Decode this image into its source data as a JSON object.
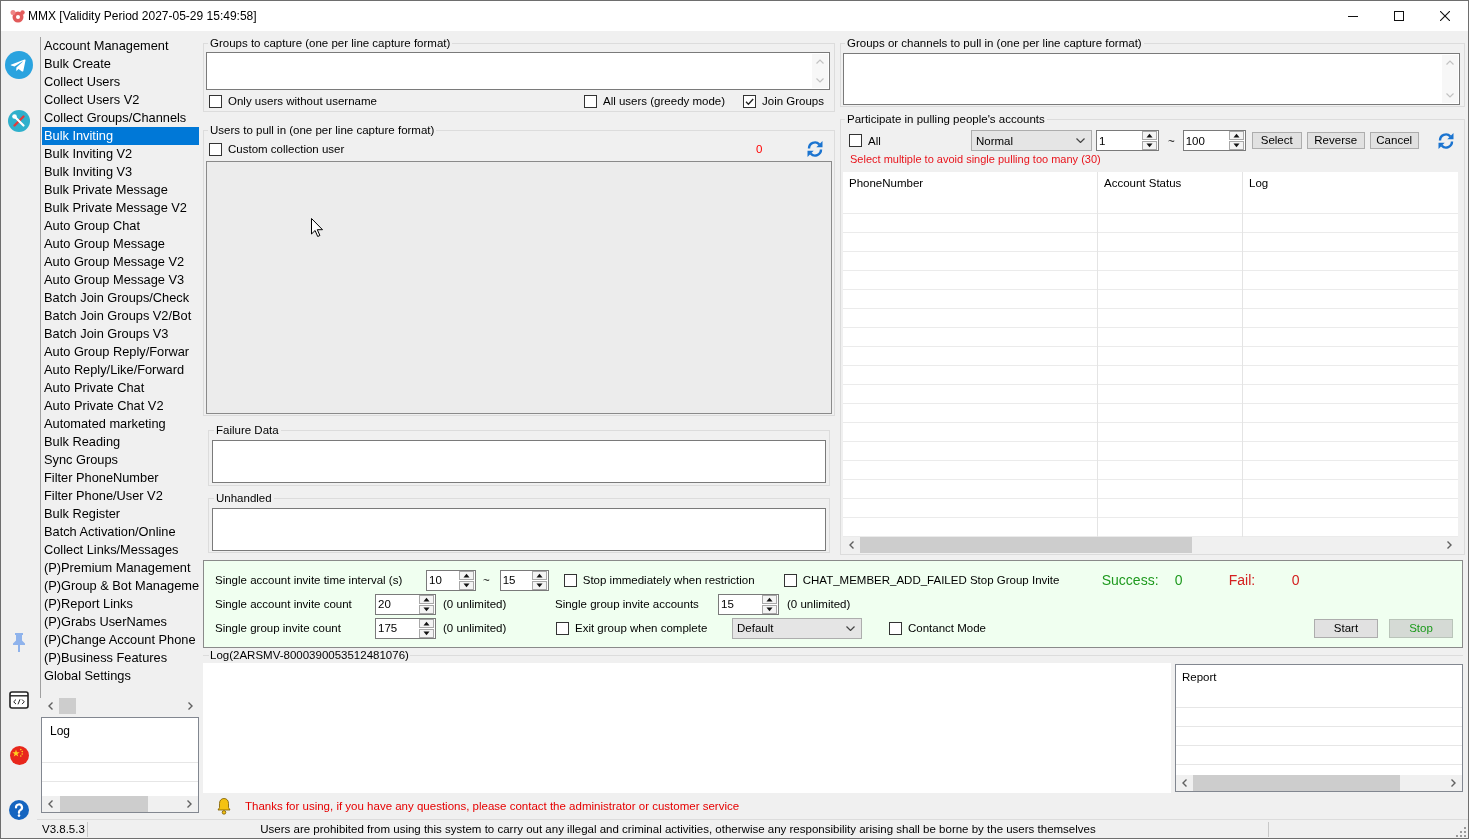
{
  "window": {
    "title": "MMX [Validity Period 2027-05-29 15:49:58]"
  },
  "sidebar": {
    "items": [
      {
        "label": "Account Management",
        "selected": false
      },
      {
        "label": "Bulk Create",
        "selected": false
      },
      {
        "label": "Collect Users",
        "selected": false
      },
      {
        "label": "Collect Users V2",
        "selected": false
      },
      {
        "label": "Collect Groups/Channels",
        "selected": false
      },
      {
        "label": "Bulk Inviting",
        "selected": true
      },
      {
        "label": "Bulk Inviting V2",
        "selected": false
      },
      {
        "label": "Bulk Inviting V3",
        "selected": false
      },
      {
        "label": "Bulk Private Message",
        "selected": false
      },
      {
        "label": "Bulk Private Message V2",
        "selected": false
      },
      {
        "label": "Auto Group Chat",
        "selected": false
      },
      {
        "label": "Auto Group Message",
        "selected": false
      },
      {
        "label": "Auto Group Message V2",
        "selected": false
      },
      {
        "label": "Auto Group Message V3",
        "selected": false
      },
      {
        "label": "Batch Join Groups/Check",
        "selected": false
      },
      {
        "label": "Batch Join Groups V2/Bot",
        "selected": false
      },
      {
        "label": "Batch Join Groups V3",
        "selected": false
      },
      {
        "label": "Auto Group Reply/Forwar",
        "selected": false
      },
      {
        "label": "Auto Reply/Like/Forward",
        "selected": false
      },
      {
        "label": "Auto Private Chat",
        "selected": false
      },
      {
        "label": "Auto Private Chat V2",
        "selected": false
      },
      {
        "label": "Automated marketing",
        "selected": false
      },
      {
        "label": "Bulk Reading",
        "selected": false
      },
      {
        "label": "Sync Groups",
        "selected": false
      },
      {
        "label": "Filter PhoneNumber",
        "selected": false
      },
      {
        "label": "Filter Phone/User V2",
        "selected": false
      },
      {
        "label": "Bulk Register",
        "selected": false
      },
      {
        "label": "Batch Activation/Online",
        "selected": false
      },
      {
        "label": "Collect Links/Messages",
        "selected": false
      },
      {
        "label": "(P)Premium Management",
        "selected": false
      },
      {
        "label": "(P)Group & Bot Manageme",
        "selected": false
      },
      {
        "label": "(P)Report Links",
        "selected": false
      },
      {
        "label": "(P)Grabs UserNames",
        "selected": false
      },
      {
        "label": "(P)Change Account Phone",
        "selected": false
      },
      {
        "label": "(P)Business Features",
        "selected": false
      },
      {
        "label": "Global Settings",
        "selected": false
      }
    ],
    "log_list": {
      "columns": [
        "Log"
      ]
    }
  },
  "capture": {
    "title": "Groups to capture (one per line capture format)",
    "options": [
      {
        "label": "Only users without username",
        "checked": false
      },
      {
        "label": "All users (greedy mode)",
        "checked": false
      },
      {
        "label": "Join Groups",
        "checked": true
      }
    ]
  },
  "pull_users": {
    "title": "Users to pull in (one per line capture format)",
    "custom": {
      "label": "Custom collection user",
      "checked": false
    },
    "count": "0"
  },
  "failure_data": {
    "title": "Failure Data"
  },
  "unhandled": {
    "title": "Unhandled"
  },
  "targets": {
    "title": "Groups or channels to pull in (one per line capture format)"
  },
  "accounts": {
    "title": "Participate in pulling people's accounts",
    "all": {
      "label": "All",
      "checked": false
    },
    "mode": "Normal",
    "range": {
      "from": "1",
      "separator": "~",
      "to": "100"
    },
    "buttons": [
      "Select",
      "Reverse",
      "Cancel"
    ],
    "hint": "Select multiple to avoid single pulling too many (30)",
    "table": {
      "columns": [
        "PhoneNumber",
        "Account Status",
        "Log"
      ]
    }
  },
  "settings": {
    "interval": {
      "label": "Single account invite time interval (s)",
      "from": "10",
      "separator": "~",
      "to": "15"
    },
    "stop_on_restriction": {
      "label": "Stop immediately when restriction",
      "checked": false
    },
    "stop_on_add_failed": {
      "label": "CHAT_MEMBER_ADD_FAILED Stop Group Invite",
      "checked": false
    },
    "success": {
      "label": "Success:",
      "value": "0"
    },
    "fail": {
      "label": "Fail:",
      "value": "0"
    },
    "account_invite_count": {
      "label": "Single account invite count",
      "value": "20",
      "note": "(0 unlimited)"
    },
    "group_invite_accounts": {
      "label": "Single group invite accounts",
      "value": "15",
      "note": "(0 unlimited)"
    },
    "group_invite_count": {
      "label": "Single group invite count",
      "value": "175",
      "note": "(0 unlimited)"
    },
    "exit_group": {
      "label": "Exit group when complete",
      "checked": false
    },
    "exit_mode": "Default",
    "contact_mode": {
      "label": "Contanct Mode",
      "checked": false
    },
    "buttons": [
      {
        "label": "Start",
        "kind": "start"
      },
      {
        "label": "Stop",
        "kind": "stop"
      }
    ]
  },
  "log": {
    "title": "Log(2ARSMV-8000390053512481076)",
    "report": {
      "columns": [
        "Report"
      ]
    }
  },
  "notice": "Thanks for using, if you have any questions, please contact the administrator or customer service",
  "status_bar": {
    "version": "V3.8.5.3",
    "message": "Users are prohibited from using this system to carry out any illegal and criminal activities, otherwise any responsibility arising shall be borne by the users themselves"
  }
}
